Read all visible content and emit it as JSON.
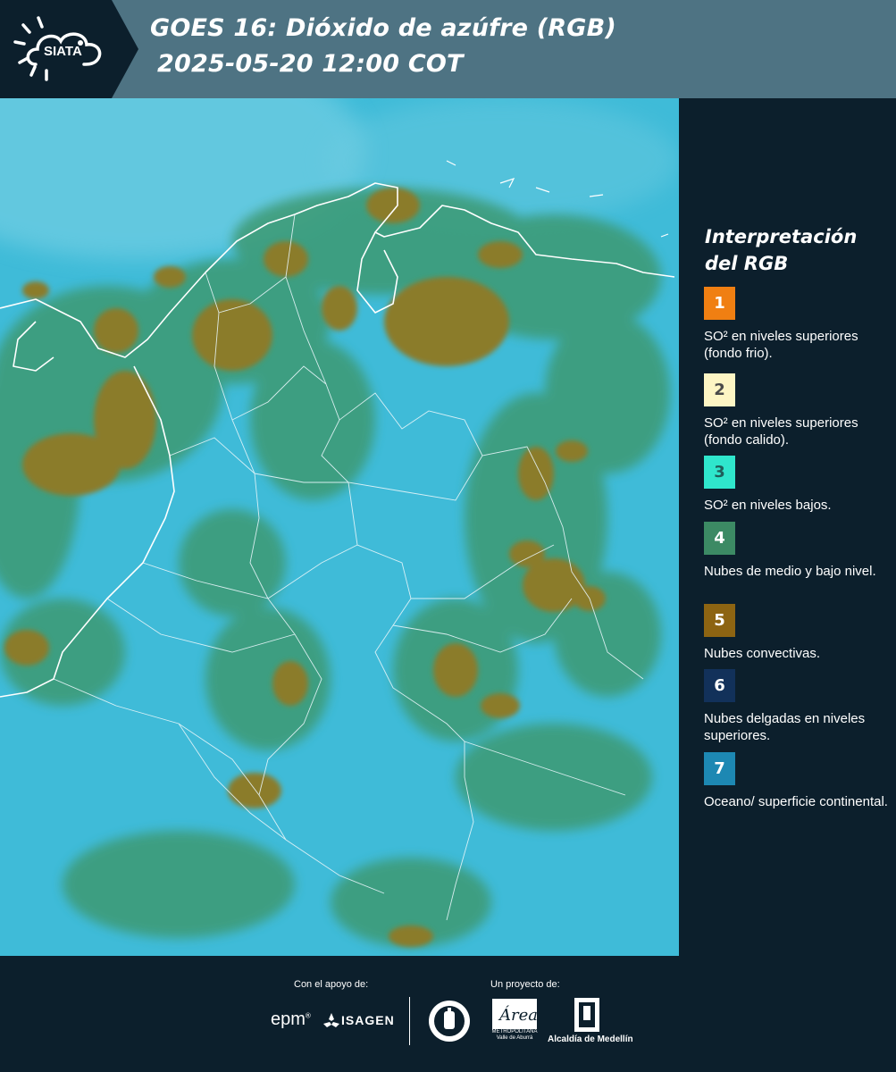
{
  "header": {
    "logo_text": "SIATA",
    "title_line1": "GOES 16: Dióxido de azúfre (RGB)",
    "title_line2": "2025-05-20 12:00 COT",
    "colors": {
      "background": "#4e7383",
      "logo_panel": "#0c1f2c"
    }
  },
  "map": {
    "icon": "satellite-map",
    "colors": {
      "surface": "#39b8d6",
      "low_clouds": "#3a8f6a",
      "convective": "#8a7a2a",
      "borders": "#ffffff"
    }
  },
  "legend": {
    "title": "Interpretación del RGB",
    "items": [
      {
        "number": "1",
        "label": "SO² en niveles superiores (fondo frio).",
        "color": "#f07f12",
        "text_color": "#ffffff"
      },
      {
        "number": "2",
        "label": "SO² en niveles superiores (fondo calido).",
        "color": "#fdf5c4",
        "text_color": "#4a4a4a"
      },
      {
        "number": "3",
        "label": "SO² en niveles bajos.",
        "color": "#2fe6cc",
        "text_color": "#1f5f5a"
      },
      {
        "number": "4",
        "label": "Nubes de medio y bajo nivel.",
        "color": "#3c8a64",
        "text_color": "#ffffff"
      },
      {
        "number": "5",
        "label": "Nubes convectivas.",
        "color": "#8d6412",
        "text_color": "#ffffff"
      },
      {
        "number": "6",
        "label": "Nubes delgadas en niveles superiores.",
        "color": "#12315a",
        "text_color": "#ffffff"
      },
      {
        "number": "7",
        "label": "Oceano/ superficie continental.",
        "color": "#1d88b3",
        "text_color": "#ffffff"
      }
    ]
  },
  "footer": {
    "support_label": "Con el apoyo de:",
    "project_label": "Un proyecto de:",
    "sponsor1": "epm",
    "sponsor2": "ISAGEN",
    "partner_area": "METROPOLITANA Valle de Aburrá",
    "partner_alcaldia": "Alcaldía de Medellín",
    "logos": [
      "epm-logo",
      "isagen-logo",
      "medellin-seal-icon",
      "area-metropolitana-logo",
      "alcaldia-medellin-logo"
    ]
  }
}
